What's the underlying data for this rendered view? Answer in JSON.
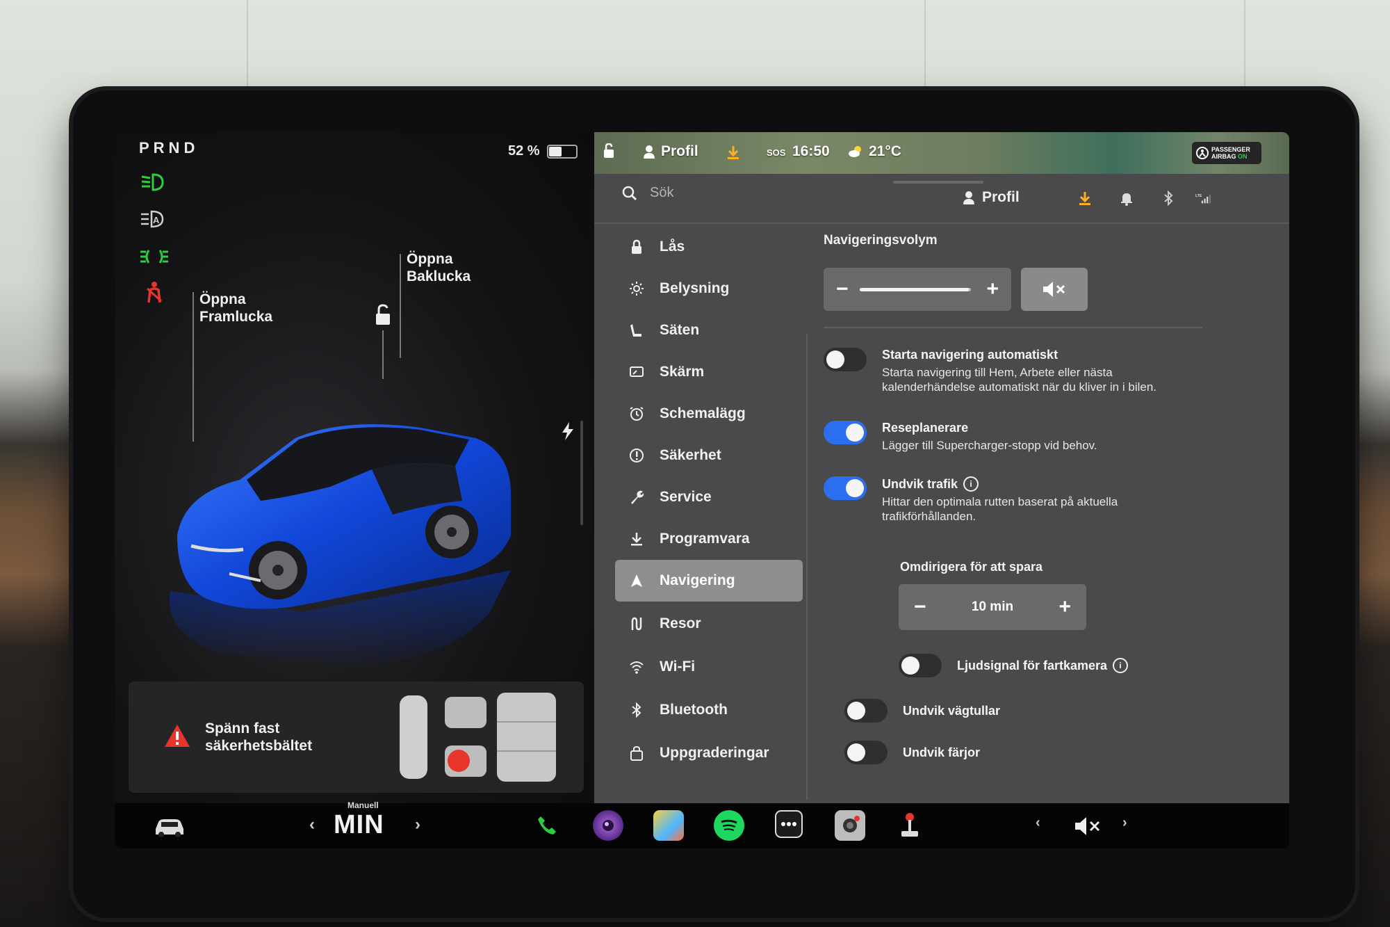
{
  "left_panel": {
    "gear": "PRND",
    "battery_percent": "52 %",
    "battery_level": 0.52,
    "callouts": {
      "front_trunk": [
        "Öppna",
        "Framlucka"
      ],
      "rear_trunk": [
        "Öppna",
        "Baklucka"
      ]
    },
    "seatbelt_warning": [
      "Spänn fast",
      "säkerhetsbältet"
    ],
    "telltale_icons": [
      "low-beam-icon",
      "auto-headlight-icon",
      "parking-light-icon",
      "seatbelt-warning-icon"
    ]
  },
  "status_bar": {
    "profile": "Profil",
    "sos": "SOS",
    "time": "16:50",
    "temperature": "21°C",
    "airbag": [
      "PASSENGER",
      "AIRBAG",
      "ON"
    ]
  },
  "top_bar": {
    "search_placeholder": "Sök",
    "profile": "Profil"
  },
  "menu": [
    {
      "label": "Lås",
      "icon": "lock-icon"
    },
    {
      "label": "Belysning",
      "icon": "sun-icon"
    },
    {
      "label": "Säten",
      "icon": "seat-icon"
    },
    {
      "label": "Skärm",
      "icon": "display-icon"
    },
    {
      "label": "Schemalägg",
      "icon": "alarm-icon"
    },
    {
      "label": "Säkerhet",
      "icon": "alert-circle-icon"
    },
    {
      "label": "Service",
      "icon": "wrench-icon"
    },
    {
      "label": "Programvara",
      "icon": "download-icon"
    },
    {
      "label": "Navigering",
      "icon": "navigation-arrow-icon",
      "active": true
    },
    {
      "label": "Resor",
      "icon": "trips-icon"
    },
    {
      "label": "Wi-Fi",
      "icon": "wifi-icon"
    },
    {
      "label": "Bluetooth",
      "icon": "bluetooth-icon"
    },
    {
      "label": "Uppgraderingar",
      "icon": "shopping-bag-icon"
    }
  ],
  "navigation": {
    "volume_label": "Navigeringsvolym",
    "volume_level": 0.98,
    "settings": [
      {
        "title": "Starta navigering automatiskt",
        "desc": "Starta navigering till Hem, Arbete eller nästa kalenderhändelse automatiskt när du kliver in i bilen.",
        "on": false
      },
      {
        "title": "Reseplanerare",
        "desc": "Lägger till Supercharger-stopp vid behov.",
        "on": true
      },
      {
        "title": "Undvik trafik",
        "desc": "Hittar den optimala rutten baserat på aktuella trafikförhållanden.",
        "on": true,
        "info": true
      }
    ],
    "reroute_label": "Omdirigera för att spara",
    "reroute_value": "10 min",
    "speed_camera": {
      "title": "Ljudsignal för fartkamera",
      "on": false
    },
    "avoid_tolls": {
      "title": "Undvik vägtullar",
      "on": false
    },
    "avoid_ferries": {
      "title": "Undvik färjor",
      "on": false
    }
  },
  "bottom_bar": {
    "climate_mode": "Manuell",
    "climate_value": "MIN",
    "apps": [
      "phone-icon",
      "camera-lens-icon",
      "toybox-icon",
      "spotify-icon",
      "more-icon",
      "dashcam-icon",
      "joystick-icon"
    ]
  },
  "colors": {
    "accent_blue": "#2b6ff0",
    "telltale_green": "#2ecc40",
    "warning_red": "#e8352c"
  }
}
